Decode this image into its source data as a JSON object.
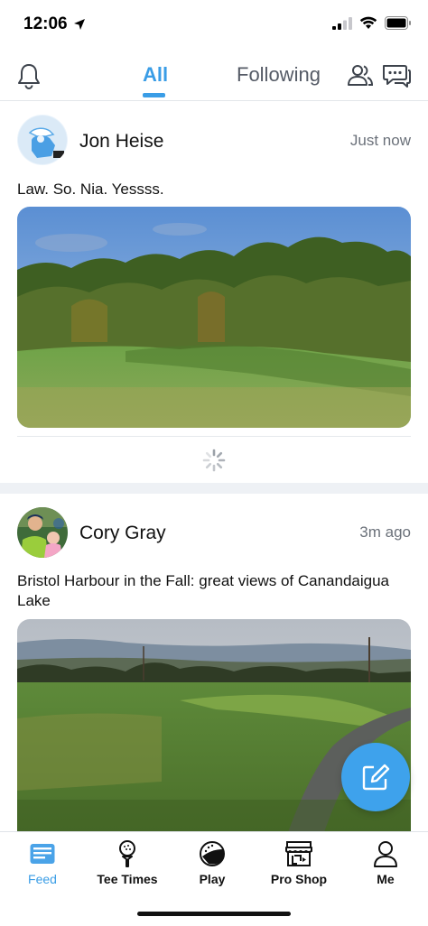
{
  "status_bar": {
    "time": "12:06"
  },
  "topnav": {
    "tabs": [
      {
        "label": "All",
        "active": true
      },
      {
        "label": "Following",
        "active": false
      }
    ]
  },
  "posts": [
    {
      "author": "Jon Heise",
      "time": "Just now",
      "text": "Law. So. Nia. Yessss.",
      "photo": "golf-course-green-with-autumn-trees"
    },
    {
      "author": "Cory Gray",
      "time": "3m ago",
      "text": "Bristol Harbour in the Fall: great views of Canandaigua Lake",
      "photo": "fairway-with-lake-view-and-cart-path"
    }
  ],
  "fab": {
    "icon": "compose-icon"
  },
  "tabbar": {
    "items": [
      {
        "label": "Feed",
        "icon": "feed-icon",
        "active": true
      },
      {
        "label": "Tee Times",
        "icon": "tee-icon",
        "active": false
      },
      {
        "label": "Play",
        "icon": "golf-ball-icon",
        "active": false
      },
      {
        "label": "Pro Shop",
        "icon": "shop-icon",
        "active": false
      },
      {
        "label": "Me",
        "icon": "person-icon",
        "active": false
      }
    ]
  },
  "colors": {
    "accent": "#3a9de6",
    "fab": "#3ea2ec",
    "band": "#eef1f5"
  }
}
